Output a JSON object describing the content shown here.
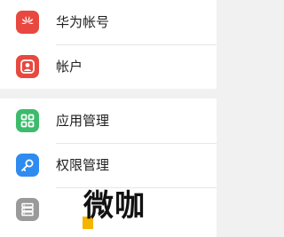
{
  "settings": {
    "items": [
      {
        "label": "华为帐号",
        "icon": "huawei-logo-icon",
        "color": "#e8483f"
      },
      {
        "label": "帐户",
        "icon": "account-icon",
        "color": "#e8483f"
      },
      {
        "label": "应用管理",
        "icon": "apps-grid-icon",
        "color": "#3dbb6c"
      },
      {
        "label": "权限管理",
        "icon": "key-icon",
        "color": "#2e8bef"
      },
      {
        "label": "",
        "icon": "storage-icon",
        "color": "#9a9a9a"
      }
    ]
  },
  "watermark": {
    "text": "微咖"
  }
}
